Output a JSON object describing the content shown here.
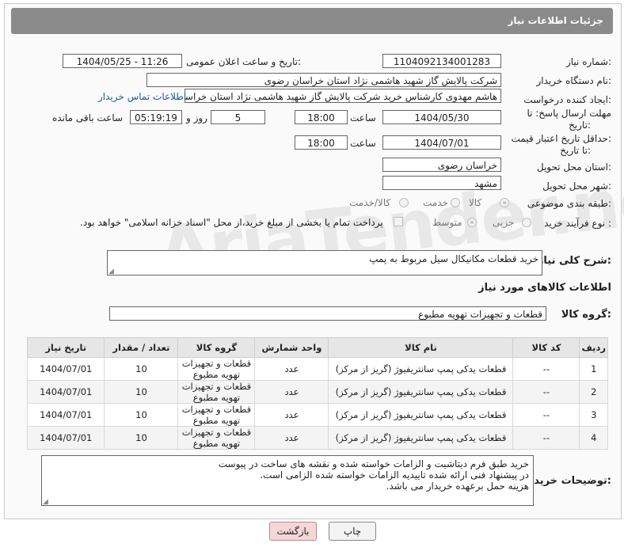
{
  "header": {
    "title": "جزئیات اطلاعات نیاز"
  },
  "watermark": "AriaTender.net",
  "fields": {
    "need_number_label": "شماره نیاز:",
    "need_number": "1104092134001283",
    "announce_label": "تاریخ و ساعت اعلان عمومی:",
    "announce_value": "1404/05/25 - 11:26",
    "buyer_org_label": "نام دستگاه خریدار:",
    "buyer_org": "شرکت پالایش گاز شهید هاشمی نژاد   استان خراسان رضوی",
    "creator_label": "ایجاد کننده درخواست:",
    "creator": "هاشم مهدوی کارشناس خرید شرکت پالایش گاز شهید هاشمی نژاد   استان خراسان رضوی",
    "contact_link": "اطلاعات تماس خریدار",
    "deadline_label_1": "مهلت ارسال پاسخ: تا",
    "deadline_label_2": "تاریخ:",
    "deadline_date": "1404/05/30",
    "time_label": "ساعت",
    "deadline_time": "18:00",
    "days_value": "5",
    "days_label": "روز و",
    "remaining_time": "05:19:19",
    "remaining_label": "ساعت باقی مانده",
    "validity_label_1": "حداقل تاریخ اعتبار قیمت:",
    "validity_label_2": "تا تاریخ:",
    "validity_date": "1404/07/01",
    "validity_time": "18:00",
    "province_label": "استان محل تحویل:",
    "province": "خراسان رضوی",
    "city_label": "شهر محل تحویل:",
    "city": "مشهد",
    "category_label": "طبقه بندی موضوعی:",
    "category_options": [
      "کالا",
      "خدمت",
      "کالا/خدمت"
    ],
    "process_label": "نوع فرآیند خرید :",
    "process_options": [
      "جزیی",
      "متوسط"
    ],
    "payment_note": "پرداخت تمام یا بخشی از مبلغ خرید،از محل \"اسناد خزانه اسلامی\" خواهد بود."
  },
  "general_desc": {
    "label": "شرح کلی نیاز:",
    "value": "خرید قطعات مکانیکال سیل مربوط به پمپ"
  },
  "goods": {
    "section_title": "اطلاعات کالاهای مورد نیاز",
    "group_label": "گروه کالا:",
    "group_value": "قطعات و تجهیزات تهویه مطبوع",
    "columns": [
      "ردیف",
      "کد کالا",
      "نام کالا",
      "واحد شمارش",
      "گروه کالا",
      "تعداد / مقدار",
      "تاریخ نیاز"
    ],
    "rows": [
      [
        "1",
        "--",
        "قطعات یدکی پمپ سانتریفیوژ (گریز از مرکز)",
        "عدد",
        "قطعات و تجهیزات تهویه مطبوع",
        "10",
        "1404/07/01"
      ],
      [
        "2",
        "--",
        "قطعات یدکی پمپ سانتریفیوژ (گریز از مرکز)",
        "عدد",
        "قطعات و تجهیزات تهویه مطبوع",
        "10",
        "1404/07/01"
      ],
      [
        "3",
        "--",
        "قطعات یدکی پمپ سانتریفیوژ (گریز از مرکز)",
        "عدد",
        "قطعات و تجهیزات تهویه مطبوع",
        "10",
        "1404/07/01"
      ],
      [
        "4",
        "--",
        "قطعات یدکی پمپ سانتریفیوژ (گریز از مرکز)",
        "عدد",
        "قطعات و تجهیزات تهویه مطبوع",
        "10",
        "1404/07/01"
      ]
    ]
  },
  "buyer_notes": {
    "label": "توضیحات خریدار:",
    "lines": [
      "خرید طبق فرم دیتاشیت و الزامات خواسته شده و نقشه های ساخت در پیوست",
      "در پیشنهاد فنی ارائه شده تاییدیه الزامات خواسته شده الزامی است.",
      "هزینه حمل برعهده خریدار می باشد."
    ]
  },
  "buttons": {
    "print": "چاپ",
    "back": "بازگشت"
  }
}
